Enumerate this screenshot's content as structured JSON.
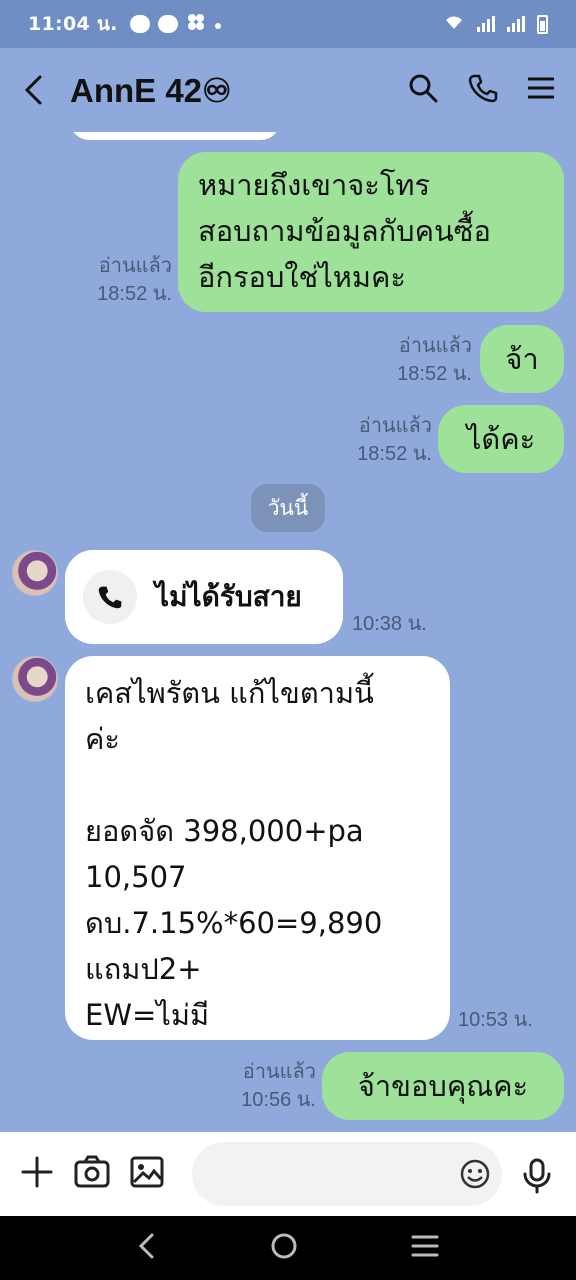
{
  "status_bar": {
    "time": "11:04 น."
  },
  "header": {
    "title": "AnnE 42♾"
  },
  "messages": [
    {
      "side": "me",
      "text": "หมายถึงเขาจะโทร\nสอบถามข้อมูลกับคนซื้อ\nอีกรอบใช่ไหมคะ",
      "read": "อ่านแล้ว",
      "time": "18:52 น."
    },
    {
      "side": "me",
      "text": "จ้า",
      "read": "อ่านแล้ว",
      "time": "18:52 น."
    },
    {
      "side": "me",
      "text": "ได้คะ",
      "read": "อ่านแล้ว",
      "time": "18:52 น."
    },
    {
      "side": "them",
      "kind": "call",
      "text": "ไม่ได้รับสาย",
      "time": "10:38 น."
    },
    {
      "side": "them",
      "text": "เคสไพรัตน แก้ไขตามนี้\nค่ะ\n\nยอดจัด 398,000+pa\n10,507\nดบ.7.15%*60=9,890\nแถมป2+\nEW=ไม่มี",
      "time": "10:53 น."
    },
    {
      "side": "me",
      "text": "จ้าขอบคุณคะ",
      "read": "อ่านแล้ว",
      "time": "10:56 น."
    }
  ],
  "date_divider": "วันนี้",
  "input": {
    "placeholder": ""
  },
  "colors": {
    "chat_bg": "#8fa9dc",
    "me_bubble": "#9ee29a",
    "them_bubble": "#ffffff"
  }
}
